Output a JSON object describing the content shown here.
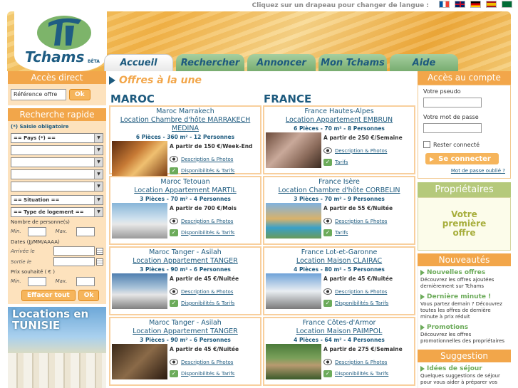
{
  "lang_bar": {
    "text": "Cliquez sur un drapeau pour changer de langue :"
  },
  "logo": {
    "name": "Tchams",
    "beta": "BÊTA"
  },
  "tabs": [
    {
      "label": "Accueil",
      "width": 97
    },
    {
      "label": "Rechercher",
      "width": 96
    },
    {
      "label": "Annoncer",
      "width": 96
    },
    {
      "label": "Mon Tchams",
      "width": 96
    },
    {
      "label": "Aide",
      "width": 96
    }
  ],
  "left": {
    "acces_direct": "Accès direct",
    "ref_placeholder": "Référence offre",
    "ok": "Ok",
    "recherche_rapide": "Recherche rapide",
    "saisie": "(*) Saisie obligatoire",
    "pays": "== Pays (*) ==",
    "situation": "== Situation ==",
    "type_logement": "== Type de logement ==",
    "nb_personnes": "Nombre de personne(s)",
    "min": "Min.",
    "max": "Max.",
    "dates": "Dates (JJ/MM/AAAA)",
    "arrivee": "Arrivée le",
    "sortie": "Sortie le",
    "prix": "Prix souhaité ( € )",
    "effacer": "Effacer tout",
    "banner": "Locations en TUNISIE"
  },
  "main": {
    "title": "Offres à la une",
    "countries": [
      "MAROC",
      "FRANCE"
    ],
    "desc_link": "Description & Photos",
    "dispo_link": "Disponibilités & Tarifs",
    "tarifs_link": "Tarifs",
    "cards": [
      {
        "region": "Maroc Marrakech",
        "title": "Location Chambre d'hôte MARRAKECH MEDINA",
        "specs": "6 Pièces - 360 m² - 12 Personnes",
        "price": "A partir de 150 €/Week-End"
      },
      {
        "region": "France Hautes-Alpes",
        "title": "Location Appartement EMBRUN",
        "specs": "6 Pièces - 70 m² - 8 Personnes",
        "price": "A partir de 250 €/Semaine"
      },
      {
        "region": "Maroc Tetouan",
        "title": "Location Appartement MARTIL",
        "specs": "3 Pièces - 70 m² - 4 Personnes",
        "price": "A partir de 700 €/Mois"
      },
      {
        "region": "France Isère",
        "title": "Location Chambre d'hôte CORBELIN",
        "specs": "3 Pièces - 70 m² - 9 Personnes",
        "price": "A partir de 55 €/Nuitée"
      },
      {
        "region": "Maroc Tanger - Asilah",
        "title": "Location Appartement TANGER",
        "specs": "3 Pièces - 90 m² - 6 Personnes",
        "price": "A partir de 45 €/Nuitée"
      },
      {
        "region": "France Lot-et-Garonne",
        "title": "Location Maison CLAIRAC",
        "specs": "4 Pièces - 80 m² - 5 Personnes",
        "price": "A partir de 45 €/Nuitée"
      },
      {
        "region": "Maroc Tanger - Asilah",
        "title": "Location Appartement TANGER",
        "specs": "3 Pièces - 90 m² - 6 Personnes",
        "price": "A partir de 45 €/Nuitée"
      },
      {
        "region": "France Côtes-d'Armor",
        "title": "Location Maison PAIMPOL",
        "specs": "4 Pièces - 64 m² - 4 Personnes",
        "price": "A partir de 275 €/Semaine"
      }
    ]
  },
  "right": {
    "acces_compte": "Accès au compte",
    "pseudo": "Votre pseudo",
    "passe": "Votre mot de passe",
    "rester": "Rester connecté",
    "connect": "Se connecter",
    "forgot": "Mot de passe oublié ?",
    "proprietaires": "Propriétaires",
    "premiere_offre": "Votre première offre",
    "nouveautes": "Nouveautés",
    "news": [
      {
        "title": "Nouvelles offres",
        "text": "Découvrez les offres ajoutées dernièrement sur Tchams"
      },
      {
        "title": "Dernière minute !",
        "text": "Vous partez demain ? Découvrez toutes les offres de dernière minute à prix réduit"
      },
      {
        "title": "Promotions",
        "text": "Découvrez les offres promotionnelles des propriétaires"
      }
    ],
    "suggestion": "Suggestion",
    "sugg_title": "Idées de séjour",
    "sugg_text": "Quelques suggestions de séjour pour vous aider à préparer vos"
  }
}
